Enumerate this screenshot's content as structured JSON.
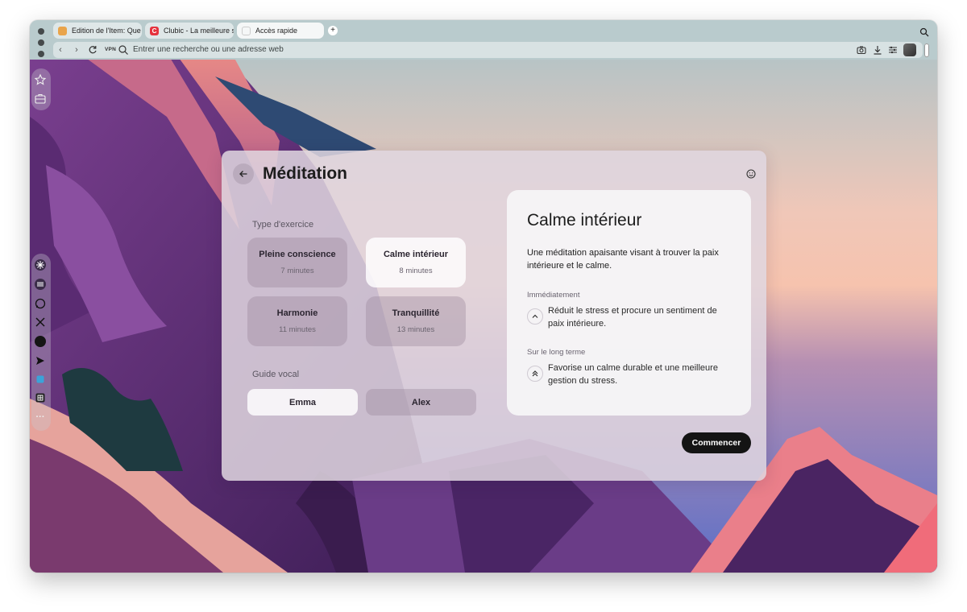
{
  "browser": {
    "tabs": [
      {
        "label": "Edition de l'Item: Que",
        "active": false
      },
      {
        "label": "Clubic - La meilleure sc",
        "active": false
      },
      {
        "label": "Accès rapide",
        "active": true
      }
    ],
    "new_tab_label": "+",
    "vpn_label": "VPN",
    "address_placeholder": "Entrer une recherche ou une adresse web"
  },
  "sidebar": {
    "top_icons": [
      "star-icon",
      "briefcase-icon"
    ],
    "app_icons": [
      "perplexity-icon",
      "openai-icon",
      "whatsapp-icon",
      "x-icon",
      "circle-app-icon",
      "send-icon",
      "extension-icon",
      "grid-app-icon"
    ],
    "more_label": "···"
  },
  "meditation": {
    "title": "Méditation",
    "exercise_section_label": "Type d'exercice",
    "exercises": [
      {
        "name": "Pleine conscience",
        "duration": "7 minutes",
        "selected": false
      },
      {
        "name": "Calme intérieur",
        "duration": "8 minutes",
        "selected": true
      },
      {
        "name": "Harmonie",
        "duration": "11 minutes",
        "selected": false
      },
      {
        "name": "Tranquillité",
        "duration": "13 minutes",
        "selected": false
      }
    ],
    "voice_section_label": "Guide vocal",
    "voices": [
      {
        "name": "Emma",
        "selected": true
      },
      {
        "name": "Alex",
        "selected": false
      }
    ],
    "detail": {
      "title": "Calme intérieur",
      "description": "Une méditation apaisante visant à trouver la paix intérieure et le calme.",
      "immediate_label": "Immédiatement",
      "immediate_text": "Réduit le stress et procure un sentiment de paix intérieure.",
      "long_term_label": "Sur le long terme",
      "long_term_text": "Favorise un calme durable et une meilleure gestion du stress."
    },
    "start_label": "Commencer"
  },
  "colors": {
    "accent_dark": "#141414",
    "topbar": "#b9cbcd",
    "panel": "#e0d6e0"
  }
}
